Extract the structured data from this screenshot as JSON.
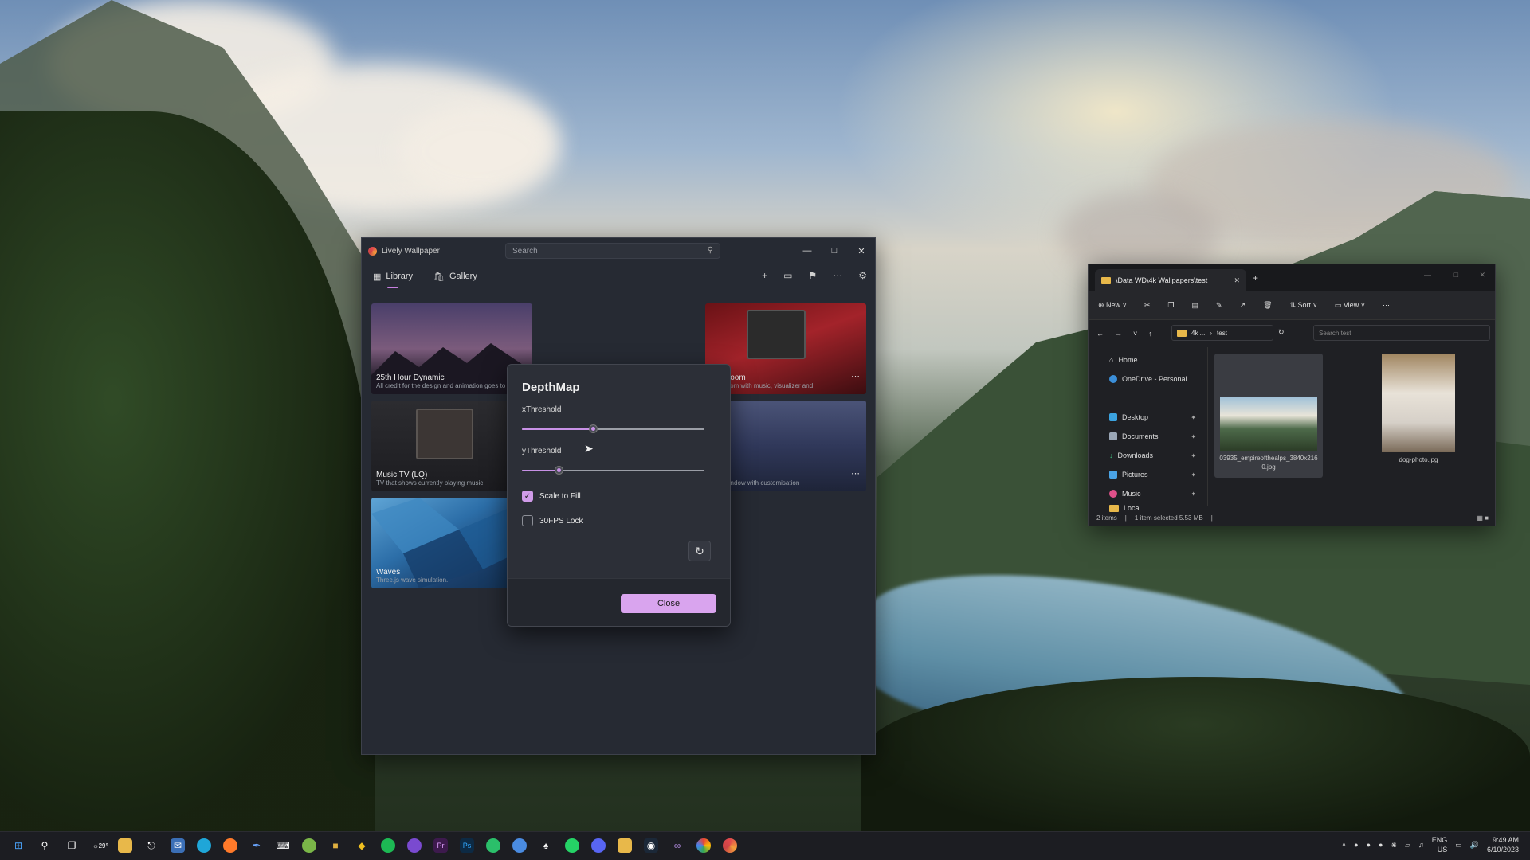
{
  "lively": {
    "title": "Lively Wallpaper",
    "search_placeholder": "Search",
    "tabs": [
      {
        "label": "Library"
      },
      {
        "label": "Gallery"
      }
    ],
    "tiles": [
      {
        "title": "25th Hour Dynamic",
        "desc": "All credit for the design and animation goes to Louis Coyle, this is just a dynami..."
      },
      {
        "title": "Room",
        "desc": "room with music, visualizer and"
      },
      {
        "title": "Music TV (LQ)",
        "desc": "TV that shows currently playing music"
      },
      {
        "title": "",
        "desc": "window with customisation"
      },
      {
        "title": "Waves",
        "desc": "Three.js wave simulation."
      }
    ]
  },
  "dialog": {
    "title": "DepthMap",
    "x_label": "xThreshold",
    "y_label": "yThreshold",
    "x_value": 0.39,
    "y_value": 0.2,
    "scale_to_fill": {
      "label": "Scale to Fill",
      "checked": true
    },
    "fps_lock": {
      "label": "30FPS Lock",
      "checked": false
    },
    "close_label": "Close"
  },
  "explorer": {
    "tab_title": "\\Data WD\\4k Wallpapers\\test",
    "toolbar": {
      "new": "New",
      "sort": "Sort",
      "view": "View"
    },
    "path": [
      "4k ...",
      "test"
    ],
    "search_placeholder": "Search test",
    "nav": [
      {
        "label": "Home"
      },
      {
        "label": "OneDrive - Personal"
      },
      {
        "label": "Desktop"
      },
      {
        "label": "Documents"
      },
      {
        "label": "Downloads"
      },
      {
        "label": "Pictures"
      },
      {
        "label": "Music"
      },
      {
        "label": "Local"
      }
    ],
    "files": [
      {
        "name": "03935_empireofthealps_3840x2160.jpg"
      },
      {
        "name": "dog-photo.jpg"
      }
    ],
    "status": {
      "items": "2 items",
      "selected": "1 item selected 5.53 MB"
    }
  },
  "taskbar": {
    "lang": "ENG",
    "region": "US",
    "time": "9:49 AM",
    "date": "6/10/2023",
    "weather_temp": "29°"
  }
}
